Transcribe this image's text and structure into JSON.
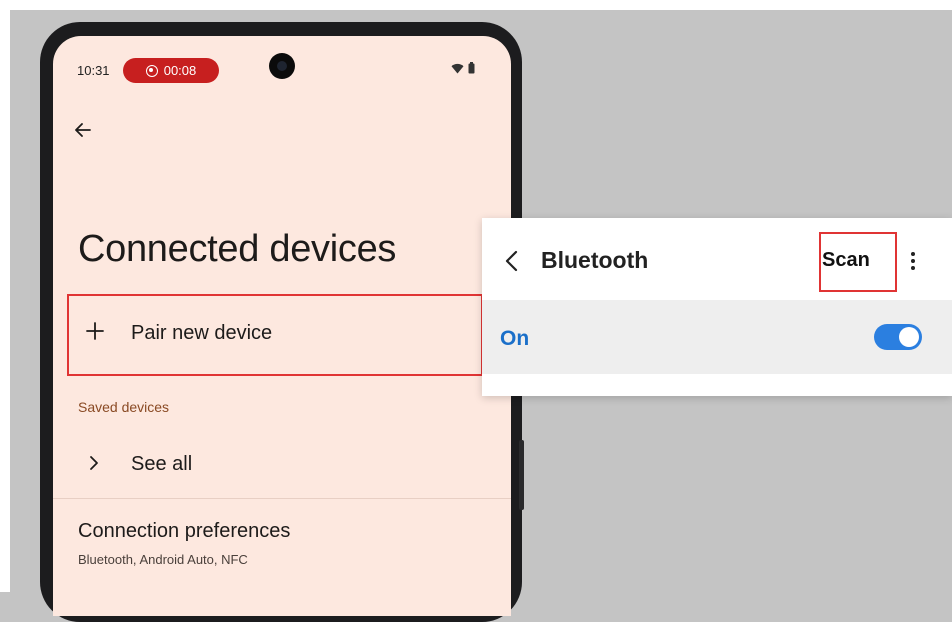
{
  "status_bar": {
    "time": "10:31",
    "recording": "00:08"
  },
  "settings": {
    "title": "Connected devices",
    "pair_new_device": "Pair new device",
    "saved_devices_header": "Saved devices",
    "see_all": "See all",
    "connection_preferences": {
      "title": "Connection preferences",
      "subtitle": "Bluetooth, Android Auto, NFC"
    }
  },
  "bluetooth_panel": {
    "title": "Bluetooth",
    "scan_label": "Scan",
    "on_label": "On",
    "toggle_on": true
  },
  "colors": {
    "highlight": "#e03434",
    "record_pill": "#c71f1f",
    "toggle_accent": "#2b7fe0",
    "screen_bg": "#fde8df"
  },
  "icons": [
    "back-arrow-icon",
    "plus-icon",
    "chevron-right-icon",
    "record-icon",
    "wifi-icon",
    "battery-icon",
    "chevron-left-icon",
    "more-vert-icon"
  ]
}
